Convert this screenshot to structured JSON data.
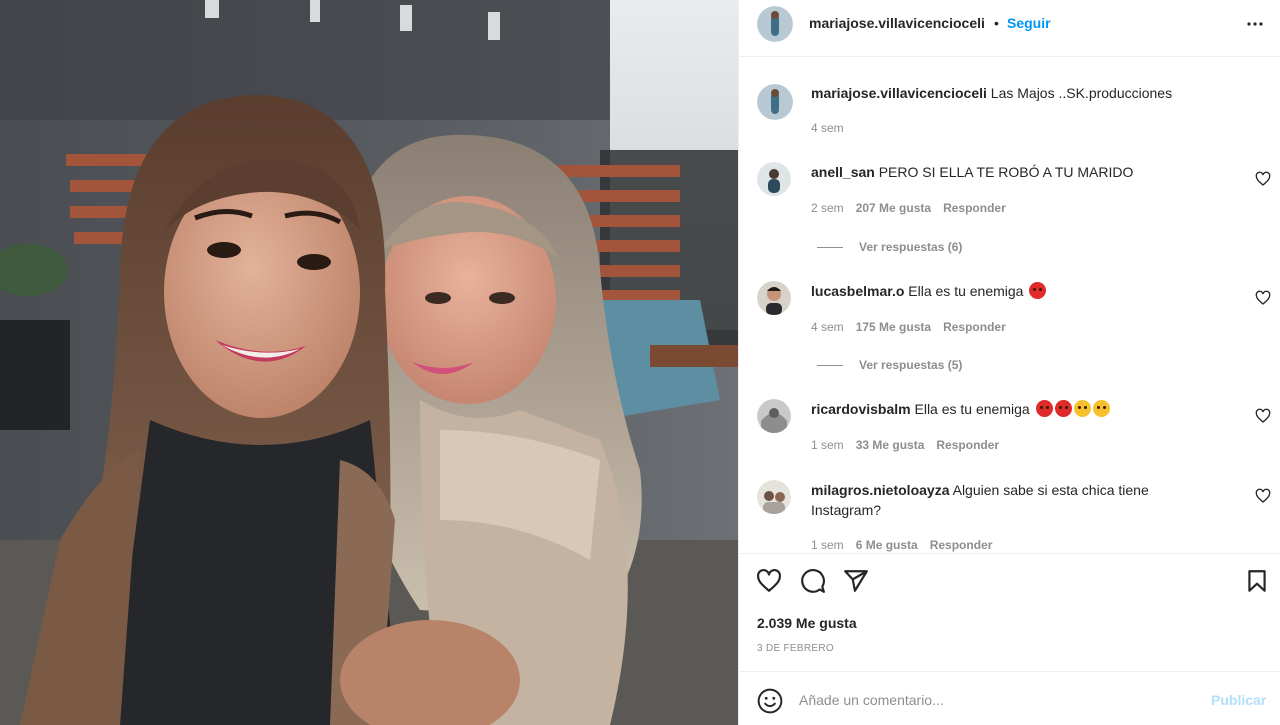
{
  "post": {
    "author": "mariajose.villavicencioceli",
    "follow_label": "Seguir",
    "separator": "•",
    "caption": {
      "user": "mariajose.villavicencioceli",
      "text": "Las Majos ..SK.producciones",
      "time": "4 sem"
    }
  },
  "comments": [
    {
      "user": "anell_san",
      "text": "PERO SI ELLA TE ROBÓ A TU MARIDO",
      "time": "2 sem",
      "likes": "207 Me gusta",
      "reply_label": "Responder",
      "view_replies": "Ver respuestas (6)"
    },
    {
      "user": "lucasbelmar.o",
      "text": "Ella es tu enemiga",
      "time": "4 sem",
      "likes": "175 Me gusta",
      "reply_label": "Responder",
      "view_replies": "Ver respuestas (5)"
    },
    {
      "user": "ricardovisbalm",
      "text": "Ella es tu enemiga",
      "time": "1 sem",
      "likes": "33 Me gusta",
      "reply_label": "Responder"
    },
    {
      "user": "milagros.nietoloayza",
      "text": "Alguien sabe si esta chica tiene Instagram?",
      "time": "1 sem",
      "likes": "6 Me gusta",
      "reply_label": "Responder"
    }
  ],
  "actions": {
    "likes": "2.039 Me gusta",
    "date": "3 DE FEBRERO"
  },
  "composer": {
    "placeholder": "Añade un comentario...",
    "post_label": "Publicar"
  },
  "colors": {
    "accent": "#0095f6",
    "publish_disabled": "#b2dffc",
    "muted": "#8e8e8e",
    "text": "#262626"
  },
  "icons": [
    "more-icon",
    "heart-icon",
    "comment-icon",
    "share-icon",
    "bookmark-icon",
    "emoji-icon"
  ]
}
